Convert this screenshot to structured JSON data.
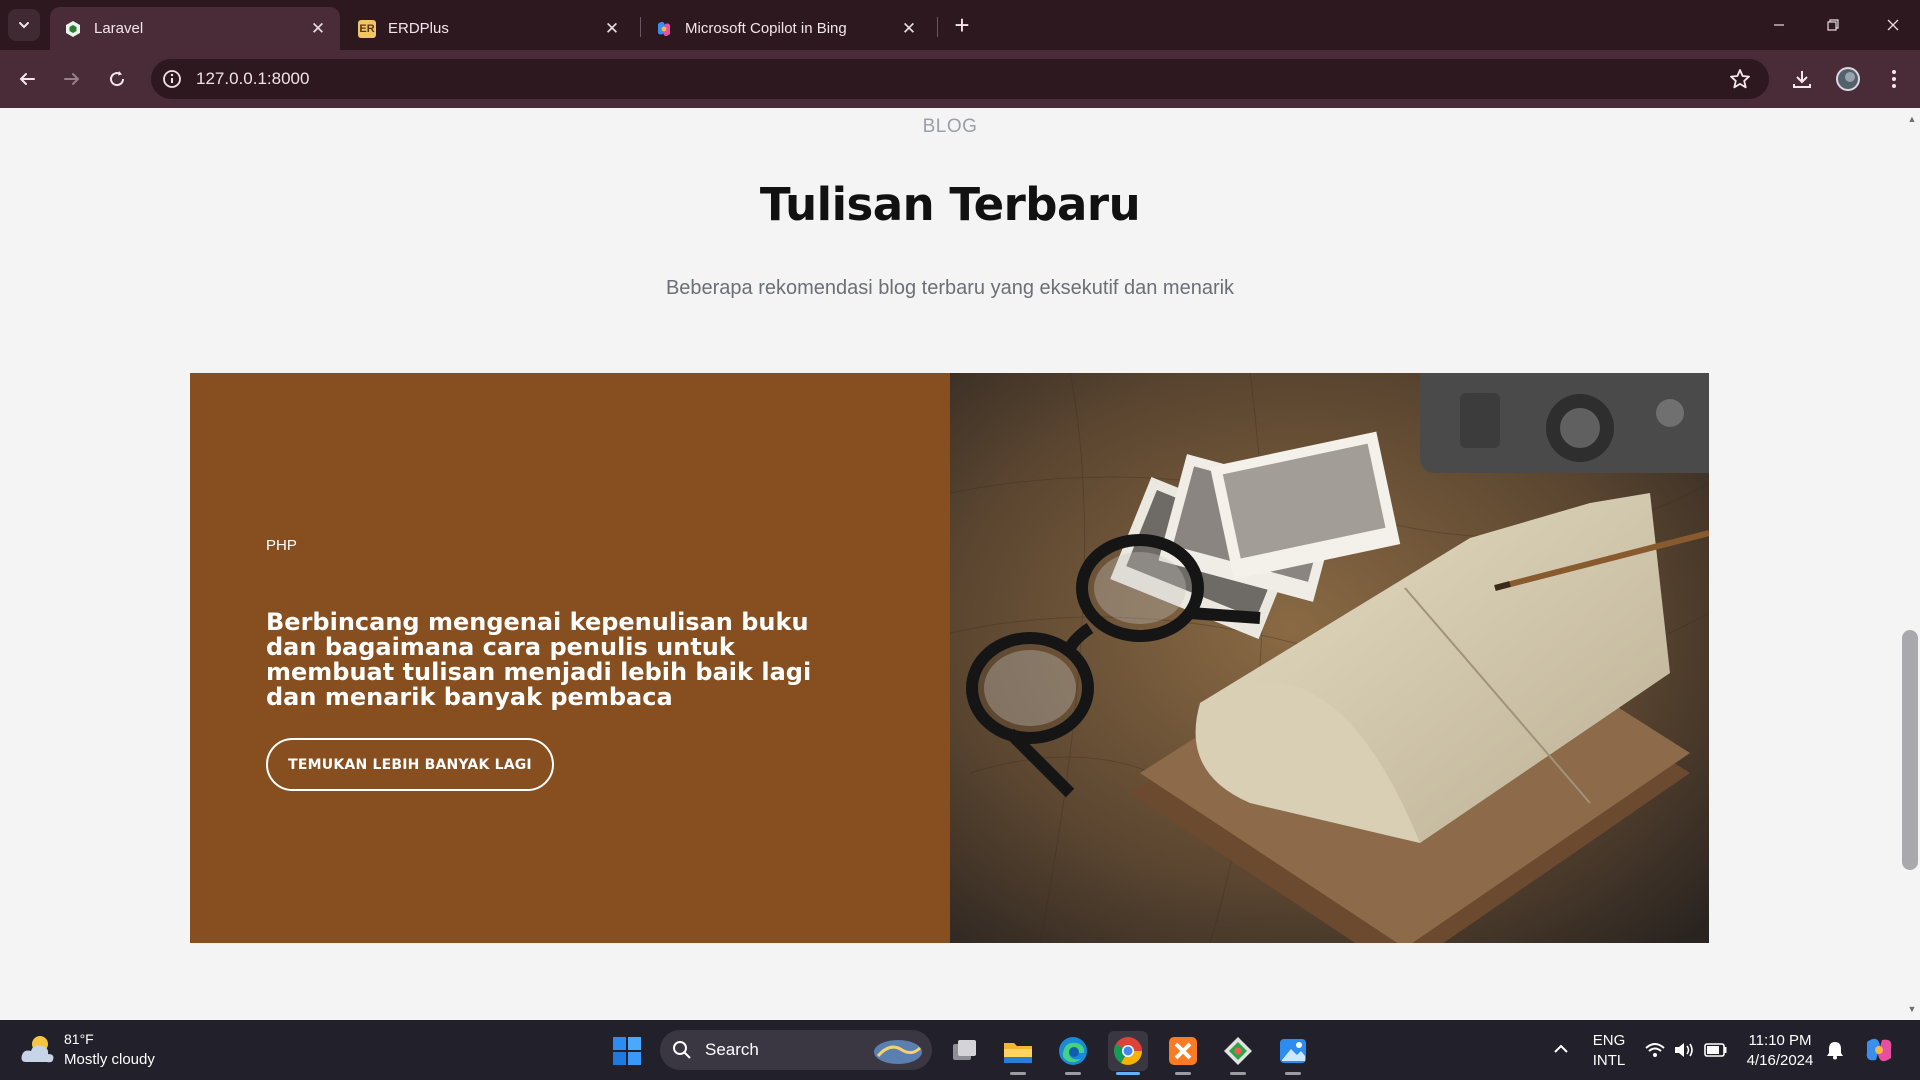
{
  "browser": {
    "tabs": [
      {
        "label": "Laravel",
        "icon": "laravel-favicon-icon",
        "active": true
      },
      {
        "label": "ERDPlus",
        "icon": "erdplus-favicon-icon",
        "active": false
      },
      {
        "label": "Microsoft Copilot in Bing",
        "icon": "copilot-favicon-icon",
        "active": false
      }
    ],
    "new_tab_label": "+",
    "address": "127.0.0.1:8000"
  },
  "page": {
    "eyebrow": "BLOG",
    "title": "Tulisan Terbaru",
    "subtitle": "Beberapa rekomendasi blog terbaru yang eksekutif dan menarik",
    "featured": {
      "category": "PHP",
      "title": "Berbincang mengenai kepenulisan buku dan bagaimana cara penulis untuk membuat tulisan menjadi lebih baik lagi dan menarik banyak pembaca",
      "cta": "TEMUKAN LEBIH BANYAK LAGI",
      "image": "notebook-glasses-photos-map-photo"
    }
  },
  "taskbar": {
    "weather_temp": "81°F",
    "weather_condition": "Mostly cloudy",
    "search_label": "Search",
    "language_top": "ENG",
    "language_bottom": "INTL",
    "time": "11:10 PM",
    "date": "4/16/2024"
  },
  "colors": {
    "card_brown": "#874f20",
    "browser_dark": "#2d1820",
    "browser_toolbar": "#4a2b38"
  }
}
